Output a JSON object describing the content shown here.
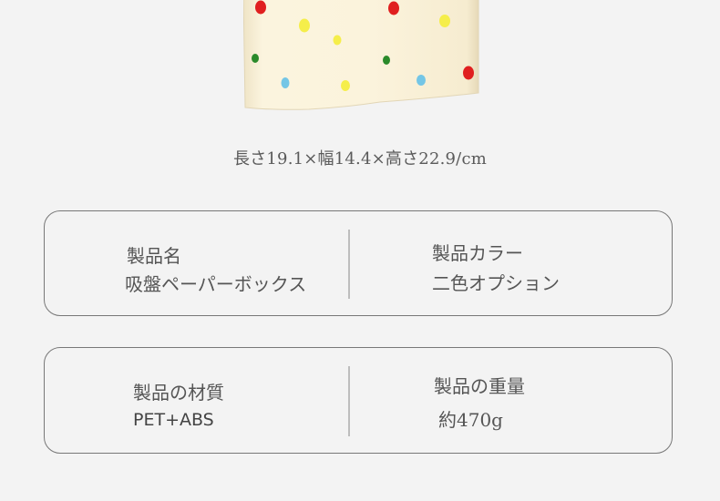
{
  "dimensions_text": "長さ19.1×幅14.4×高さ22.9/cm",
  "specs": [
    {
      "left_label": "製品名",
      "left_value": "吸盤ペーパーボックス",
      "right_label": "製品カラー",
      "right_value": "二色オプション"
    },
    {
      "left_label": "製品の材質",
      "left_value": "PET+ABS",
      "right_label": "製品の重量",
      "right_value": "約470g"
    }
  ],
  "colors": {
    "background": "#f3f3f3",
    "box_body": "#f8f0d9",
    "dot_red": "#e01f1f",
    "dot_yellow": "#f5ee4a",
    "dot_green": "#2a8a2a",
    "dot_blue": "#74c6e6"
  }
}
